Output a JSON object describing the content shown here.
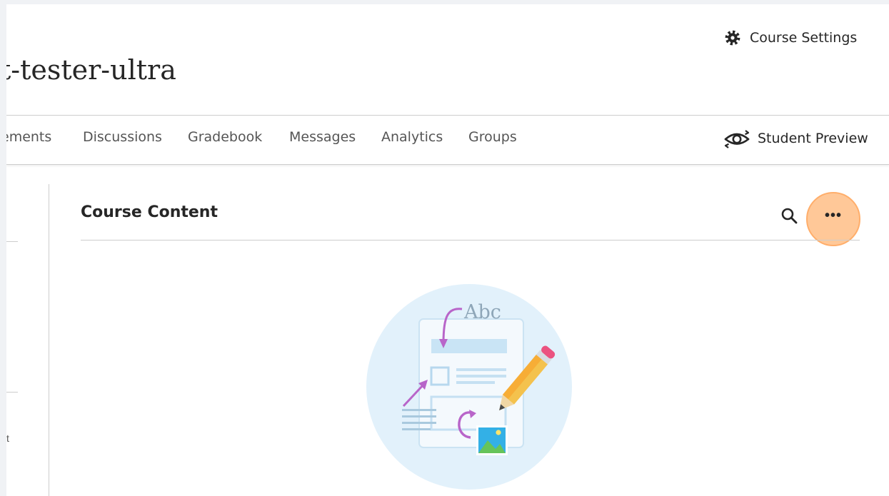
{
  "header": {
    "course_settings_label": "Course Settings",
    "course_title": "t-tester-ultra"
  },
  "nav": {
    "items": [
      {
        "label": "ements"
      },
      {
        "label": "Discussions"
      },
      {
        "label": "Gradebook"
      },
      {
        "label": "Messages"
      },
      {
        "label": "Analytics"
      },
      {
        "label": "Groups"
      }
    ],
    "student_preview_label": "Student Preview"
  },
  "content": {
    "title": "Course Content",
    "illustration_text": "Abc"
  },
  "left_panel": {
    "glyph": "t"
  },
  "icons": {
    "settings": "gear-icon",
    "preview": "eye-refresh-icon",
    "search": "search-icon",
    "more": "more-options-icon"
  },
  "colors": {
    "highlight_fill": "#ffc898",
    "highlight_ring": "#ffae6b",
    "text": "#262626",
    "nav_text": "#555555"
  }
}
